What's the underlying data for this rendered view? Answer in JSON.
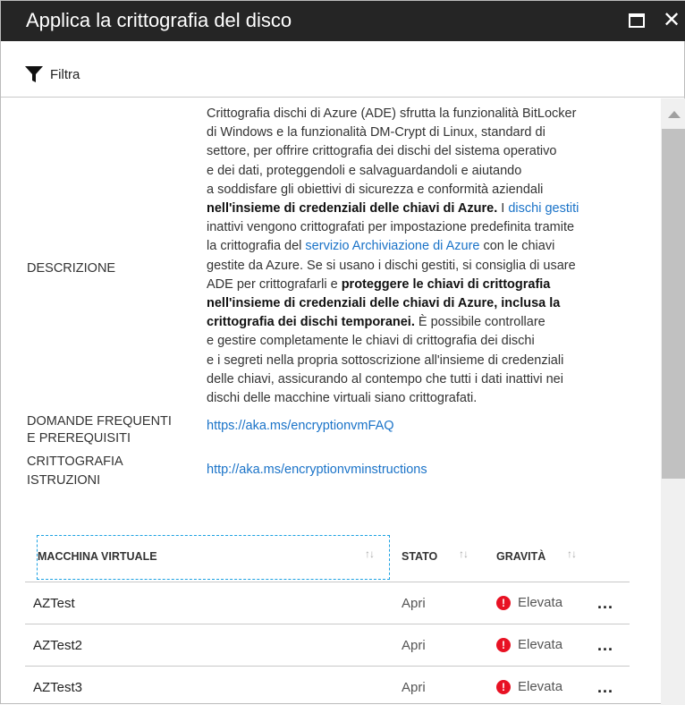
{
  "window": {
    "title": "Applica la crittografia del disco"
  },
  "toolbar": {
    "filter_label": "Filtra"
  },
  "details": {
    "description_label": "DESCRIZIONE",
    "description_lines": [
      [
        {
          "t": "Crittografia dischi di Azure (ADE) sfrutta la funzionalità BitLocker"
        }
      ],
      [
        {
          "t": "di Windows e la funzionalità DM-Crypt di Linux, standard di"
        }
      ],
      [
        {
          "t": "settore, per offrire crittografia dei dischi del sistema operativo"
        }
      ],
      [
        {
          "t": "e dei dati, proteggendoli e salvaguardandoli e aiutando"
        }
      ],
      [
        {
          "t": "a soddisfare gli obiettivi di sicurezza e conformità aziendali"
        }
      ],
      [
        {
          "t": "nell'insieme di credenziali delle chiavi di Azure.",
          "s": "b"
        },
        {
          "t": " I "
        },
        {
          "t": "dischi gestiti",
          "s": "a"
        }
      ],
      [
        {
          "t": "inattivi vengono crittografati per impostazione predefinita tramite"
        }
      ],
      [
        {
          "t": "la crittografia del "
        },
        {
          "t": "servizio Archiviazione di Azure",
          "s": "a"
        },
        {
          "t": " con le chiavi"
        }
      ],
      [
        {
          "t": "gestite da Azure. Se si usano i dischi gestiti, si consiglia di usare"
        }
      ],
      [
        {
          "t": "ADE per crittografarli e "
        },
        {
          "t": "proteggere le chiavi di crittografia",
          "s": "b"
        }
      ],
      [
        {
          "t": "nell'insieme di credenziali delle chiavi di Azure, inclusa la",
          "s": "b"
        }
      ],
      [
        {
          "t": "crittografia dei dischi temporanei.",
          "s": "b"
        },
        {
          "t": " È possibile controllare"
        }
      ],
      [
        {
          "t": "e gestire completamente le chiavi di crittografia dei dischi"
        }
      ],
      [
        {
          "t": "e i segreti nella propria sottoscrizione all'insieme di credenziali"
        }
      ],
      [
        {
          "t": "delle chiavi, assicurando al contempo che tutti i dati inattivi nei"
        }
      ],
      [
        {
          "t": "dischi delle macchine virtuali siano crittografati."
        }
      ]
    ],
    "faq_label_1": "DOMANDE FREQUENTI",
    "faq_label_2": "E PREREQUISITI",
    "faq_link": "https://aka.ms/encryptionvmFAQ",
    "instr_label_1": "CRITTOGRAFIA",
    "instr_label_2": "ISTRUZIONI",
    "instr_link": "http://aka.ms/encryptionvminstructions"
  },
  "table": {
    "columns": [
      "MACCHINA VIRTUALE",
      "STATO",
      "GRAVITÀ"
    ],
    "sort_glyph": "↑↓",
    "more_glyph": "...",
    "severity_color": "#e81123",
    "rows": [
      {
        "vm": "AZTest",
        "status": "Apri",
        "severity": "Elevata"
      },
      {
        "vm": "AZTest2",
        "status": "Apri",
        "severity": "Elevata"
      },
      {
        "vm": "AZTest3",
        "status": "Apri",
        "severity": "Elevata"
      }
    ]
  }
}
